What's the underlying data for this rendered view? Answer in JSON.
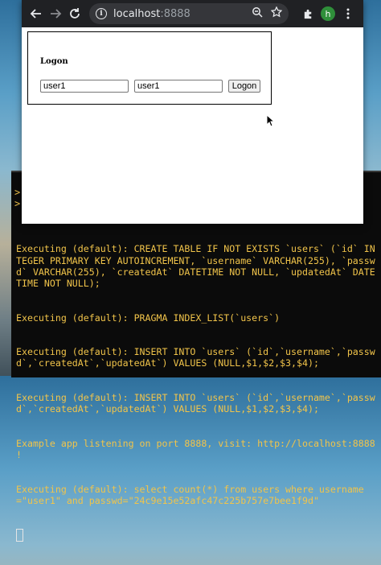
{
  "browser": {
    "url_host": "localhost",
    "url_port": ":8888",
    "profile_initial": "h"
  },
  "page": {
    "title": "Logon",
    "username_value": "user1",
    "password_value": "user1",
    "logon_label": "Logon"
  },
  "terminal": {
    "prompt_chars": [
      ">",
      ">"
    ],
    "lines": [
      "Executing (default): CREATE TABLE IF NOT EXISTS `users` (`id` INTEGER PRIMARY KEY AUTOINCREMENT, `username` VARCHAR(255), `passwd` VARCHAR(255), `createdAt` DATETIME NOT NULL, `updatedAt` DATETIME NOT NULL);",
      "Executing (default): PRAGMA INDEX_LIST(`users`)",
      "Executing (default): INSERT INTO `users` (`id`,`username`,`passwd`,`createdAt`,`updatedAt`) VALUES (NULL,$1,$2,$3,$4);",
      "Executing (default): INSERT INTO `users` (`id`,`username`,`passwd`,`createdAt`,`updatedAt`) VALUES (NULL,$1,$2,$3,$4);",
      "Example app listening on port 8888, visit: http://localhost:8888 !",
      "Executing (default): select count(*) from users where username=\"user1\" and passwd=\"24c9e15e52afc47c225b757e7bee1f9d\""
    ]
  }
}
